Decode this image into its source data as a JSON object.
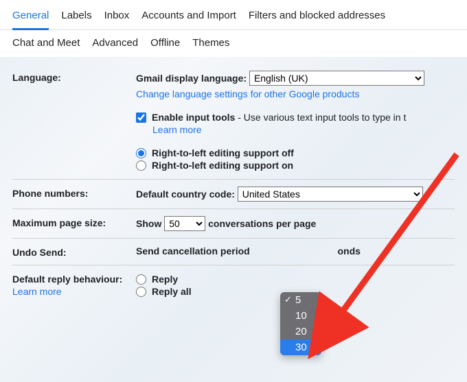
{
  "tabs_row1": {
    "general": "General",
    "labels": "Labels",
    "inbox": "Inbox",
    "accounts": "Accounts and Import",
    "filters": "Filters and blocked addresses"
  },
  "tabs_row2": {
    "chat": "Chat and Meet",
    "advanced": "Advanced",
    "offline": "Offline",
    "themes": "Themes"
  },
  "language": {
    "label": "Language:",
    "display_label": "Gmail display language:",
    "value": "English (UK)",
    "change_link": "Change language settings for other Google products",
    "enable_tools_label": "Enable input tools",
    "enable_tools_desc": " - Use various text input tools to type in t",
    "learn_more": "Learn more",
    "rtl_off": "Right-to-left editing support off",
    "rtl_on": "Right-to-left editing support on"
  },
  "phone": {
    "label": "Phone numbers:",
    "code_label": "Default country code:",
    "value": "United States"
  },
  "pagesize": {
    "label": "Maximum page size:",
    "show": "Show",
    "value": "50",
    "suffix": "conversations per page"
  },
  "undo": {
    "label": "Undo Send:",
    "period_prefix": "Send cancellation period",
    "period_suffix": "onds",
    "options": [
      "5",
      "10",
      "20",
      "30"
    ],
    "selected": "5",
    "highlighted": "30"
  },
  "reply": {
    "label": "Default reply behaviour:",
    "learn_more": "Learn more",
    "reply": "Reply",
    "reply_all": "Reply all"
  }
}
